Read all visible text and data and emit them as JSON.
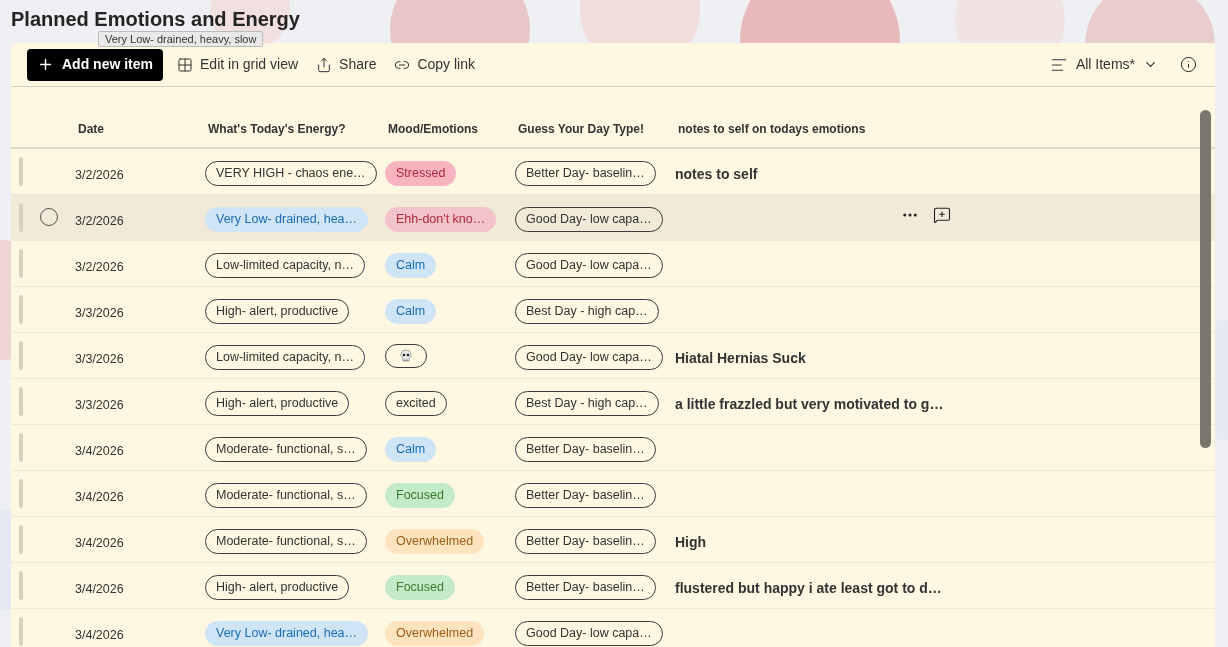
{
  "page_title": "Planned Emotions and Energy",
  "toolbar": {
    "buttons": [
      {
        "kind": "add",
        "label": "Add new item"
      },
      {
        "kind": "grid",
        "label": "Edit in grid view"
      },
      {
        "kind": "share",
        "label": "Share"
      },
      {
        "kind": "link",
        "label": "Copy link"
      }
    ],
    "view": "All Items*"
  },
  "tooltip": "Very Low- drained, heavy, slow",
  "table": {
    "columns": [
      "Date",
      "What's Today's Energy?",
      "Mood/Emotions",
      "Guess Your Day Type!",
      "notes to self on todays emotions"
    ],
    "rows": [
      {
        "hovered": false,
        "date": "3/2/2026",
        "energy": {
          "kind": "outline",
          "text": "VERY HIGH - chaos ene…"
        },
        "mood": {
          "kind": "filled",
          "color": "#f7b4bf",
          "text": "Stressed"
        },
        "day": "Better Day- baselin…",
        "notes": "notes to self"
      },
      {
        "hovered": true,
        "date": "3/2/2026",
        "energy": {
          "kind": "filled",
          "color": "#cfe4f5",
          "text": "Very Low- drained, hea…"
        },
        "mood": {
          "kind": "filled",
          "color": "#f2c3c9",
          "text": "Ehh-don't kno…"
        },
        "day": "Good Day- low capa…"
      },
      {
        "hovered": false,
        "date": "3/2/2026",
        "energy": {
          "kind": "outline",
          "text": "Low-limited capacity, n…"
        },
        "mood": {
          "kind": "filled",
          "color": "#cfe4f5",
          "text": "Calm"
        },
        "day": "Good Day- low capa…"
      },
      {
        "hovered": false,
        "date": "3/3/2026",
        "energy": {
          "kind": "outline",
          "text": "High- alert, productive"
        },
        "mood": {
          "kind": "filled",
          "color": "#cfe4f5",
          "text": "Calm"
        },
        "day": "Best Day - high cap…"
      },
      {
        "hovered": false,
        "date": "3/3/2026",
        "energy": {
          "kind": "outline",
          "text": "Low-limited capacity, n…"
        },
        "mood": {
          "kind": "skull"
        },
        "day": "Good Day- low capa…",
        "notes": "Hiatal Hernias Suck"
      },
      {
        "hovered": false,
        "date": "3/3/2026",
        "energy": {
          "kind": "outline",
          "text": "High- alert, productive"
        },
        "mood": {
          "kind": "outline",
          "text": "excited"
        },
        "day": "Best Day - high cap…",
        "notes": "a little frazzled but very motivated to g…"
      },
      {
        "hovered": false,
        "date": "3/4/2026",
        "energy": {
          "kind": "outline",
          "text": "Moderate- functional, s…"
        },
        "mood": {
          "kind": "filled",
          "color": "#cfe4f5",
          "text": "Calm"
        },
        "day": "Better Day- baselin…"
      },
      {
        "hovered": false,
        "date": "3/4/2026",
        "energy": {
          "kind": "outline",
          "text": "Moderate- functional, s…"
        },
        "mood": {
          "kind": "filled",
          "color": "#c4ebc9",
          "text": "Focused"
        },
        "day": "Better Day- baselin…"
      },
      {
        "hovered": false,
        "date": "3/4/2026",
        "energy": {
          "kind": "outline",
          "text": "Moderate- functional, s…"
        },
        "mood": {
          "kind": "filled",
          "color": "#fde4bf",
          "text": "Overwhelmed"
        },
        "day": "Better Day- baselin…",
        "notes": "High"
      },
      {
        "hovered": false,
        "date": "3/4/2026",
        "energy": {
          "kind": "outline",
          "text": "High- alert, productive"
        },
        "mood": {
          "kind": "filled",
          "color": "#c4ebc9",
          "text": "Focused"
        },
        "day": "Better Day- baselin…",
        "notes": "flustered but happy i ate least got to d…"
      },
      {
        "hovered": false,
        "date": "3/4/2026",
        "energy": {
          "kind": "filled",
          "color": "#cfe4f5",
          "text": "Very Low- drained, hea…"
        },
        "mood": {
          "kind": "filled",
          "color": "#fde4bf",
          "text": "Overwhelmed"
        },
        "day": "Good Day- low capa…"
      }
    ]
  }
}
